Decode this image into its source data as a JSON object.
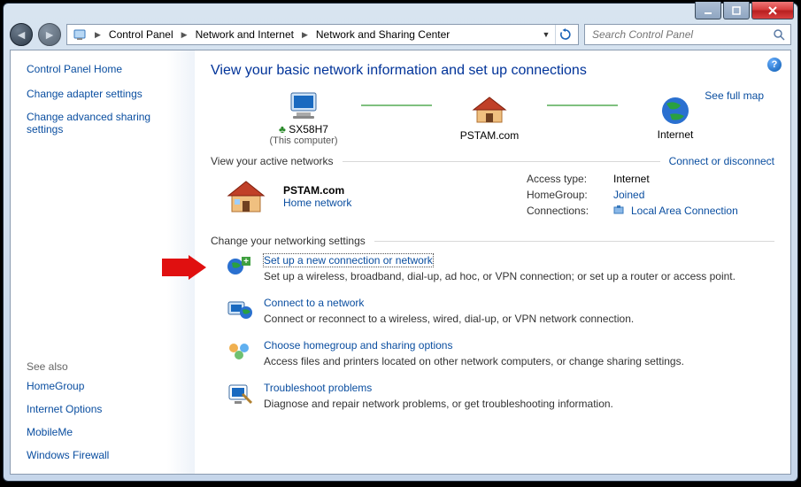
{
  "breadcrumbs": {
    "p1": "Control Panel",
    "p2": "Network and Internet",
    "p3": "Network and Sharing Center"
  },
  "search": {
    "placeholder": "Search Control Panel"
  },
  "sidebar": {
    "home": "Control Panel Home",
    "link1": "Change adapter settings",
    "link2": "Change advanced sharing settings",
    "seealso": "See also",
    "sa1": "HomeGroup",
    "sa2": "Internet Options",
    "sa3": "MobileMe",
    "sa4": "Windows Firewall"
  },
  "main": {
    "title": "View your basic network information and set up connections",
    "fullmap": "See full map",
    "map": {
      "pc": "SX58H7",
      "pc_sub": "(This computer)",
      "net": "PSTAM.com",
      "inet": "Internet"
    },
    "active_h": "View your active networks",
    "conn_disc": "Connect or disconnect",
    "active": {
      "name": "PSTAM.com",
      "type": "Home network",
      "k1": "Access type:",
      "v1": "Internet",
      "k2": "HomeGroup:",
      "v2": "Joined",
      "k3": "Connections:",
      "v3": "Local Area Connection"
    },
    "change_h": "Change your networking settings",
    "s1t": "Set up a new connection or network",
    "s1d": "Set up a wireless, broadband, dial-up, ad hoc, or VPN connection; or set up a router or access point.",
    "s2t": "Connect to a network",
    "s2d": "Connect or reconnect to a wireless, wired, dial-up, or VPN network connection.",
    "s3t": "Choose homegroup and sharing options",
    "s3d": "Access files and printers located on other network computers, or change sharing settings.",
    "s4t": "Troubleshoot problems",
    "s4d": "Diagnose and repair network problems, or get troubleshooting information."
  }
}
